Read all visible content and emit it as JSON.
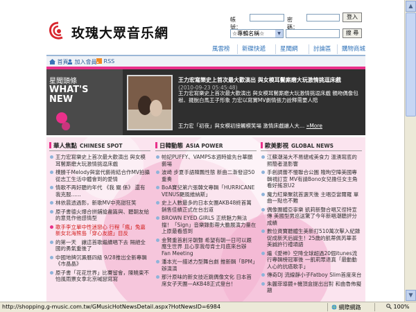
{
  "header": {
    "logo_text": "玫瑰大眾音乐網",
    "login": {
      "account_label": "帳號：",
      "password_label": "密碼：",
      "login_button": "登入"
    },
    "search": {
      "select_value": "☆專輯名稱☆",
      "search_button": "搜 尋"
    },
    "nav_tabs": [
      "風雲榜",
      "新碟快遞",
      "星聞網",
      "討論區",
      "購物商城"
    ]
  },
  "subbar": {
    "home": "首頁",
    "join": "加入會員",
    "rss": "RSS"
  },
  "headline": {
    "label": "星聞頭條",
    "en_line1": "WHAT'S",
    "en_line2": "NEW",
    "title": "王力宏寫樂史上首次最大歡演出 與女模耳鬢廝磨大玩激情挑逗床戲",
    "date": "(2010-09-23 05:45:48)",
    "description": "王力宏寫樂史上首次最大歡演出 與女模耳鬢廝磨大玩激情挑逗床戲 親吻偶像包袱、擺脫白馬王子形象 力宏以寫實MV劇情張力詮釋需要人陪",
    "second": "王力宏「初夜」與女模初接觸模笑場 激情床戲讓人大…",
    "more": "»More"
  },
  "columns": [
    {
      "title": "華人焦點",
      "title_en": "CHINESE SPOT",
      "items": [
        {
          "text": "王力宏寫樂史上首次最大歡演出 與女模耳鬢廝磨大玩激情挑逗床戲"
        },
        {
          "text": "樸勝千Melody與當代藝術結合作MV拍攝 從志工生活中體會到的愛情"
        },
        {
          "text": "情歌不再好聽的年代 《我 關 係》 還有我克服......"
        },
        {
          "text": "林依晨透過影，新歌MV中亮甜狂笑"
        },
        {
          "text": "原子書德火爆合拼鋪搶盡篇與、聽朝友給的意見作他感情型"
        },
        {
          "text": "歌手李立單中性迷戀心 行程「瘋」兔嘉新女北海熊島「穿心友誼」目反",
          "highlight": true
        },
        {
          "text": "的第一天　讓這首歌繼續唱下去 隔絕全國的勇氣重後了"
        },
        {
          "text": "中國地牌沉澱曆四級 9/28推出全新專輯《市晶晶》"
        },
        {
          "text": "原子書「花花世界」比賽留會，陳曉東不怕風雨票女拿北京喊戀寫寫"
        }
      ]
    },
    {
      "title": "日韓動態",
      "title_en": "ASIA POWER",
      "items": [
        {
          "text": "帕妃PUFFY、VAMPS本週時搶先台華願藝場"
        },
        {
          "text": "波崎 步夏手語陳飄性態 新曲二漸發迎50重奏"
        },
        {
          "text": "BoA寶兒第六張韓文專輯「HURRICANE VENUS颶風維納斯」"
        },
        {
          "text": "史上人數最多的日本女團AKB48終首萬銷售佳績正式在台出道"
        },
        {
          "text": "BROWN EYED GIRLS 正統魅力無法擋！「Sign」音樂錄影帶大膽展演力量在上原最看感到"
        },
        {
          "text": "金賢重首創牙朝聲 希望有朝一日可以跟應生世界 且心享我母肯士月底來台辦 Fan Meeting"
        },
        {
          "text": "潘本光一描述力型舞台劇 推新輯「BPM」辦演演"
        },
        {
          "text": "那汁原味的新女技近跳偶像文化 日本首席女子天團—AKB48正式登台！"
        }
      ]
    },
    {
      "title": "歐美影視",
      "title_en": "GLOBAL NEWS",
      "items": [
        {
          "text": "江蘇潮湯大不易總戒美食力 溫湧寫底的照簡者溫影響"
        },
        {
          "text": "手創調蕾不慢聯合公園 隆昫空陣美國專輯視訂宣 MV有請Bono女兒擔任女主角看好搖滾U2"
        },
        {
          "text": "魔力紅樂聚就首選天後 主唱亞當爾羅 單曲一點也不難"
        },
        {
          "text": "偶像團體亞寧樂 凱莉新聲合唱又徑特宣傳 美國型男巡送驚了今年新唱潮聽評分成績"
        },
        {
          "text": "數位資寶聽體生美新打510萬次擊入紀錄 促成新天后誕生！25歲的凱蒂佩芮華茶美誠許行禮頌語"
        },
        {
          "text": "繼《愛神》空降全球超過20個itunes流行專輯榜冠軍後 一凱莉眾退真「最動動人心的抗癌歌手」"
        },
        {
          "text": "傳奇DJ 流線靜小子Fatboy Slim首度來台"
        },
        {
          "text": "朱麗菲導鏡+機頂盒提出出對 和曲魯佈擬題"
        }
      ]
    }
  ],
  "status": {
    "url": "http://shopping.g-music.com.tw/GMusicHotNewsDetail.aspx?HotNewsID=6984",
    "zone": "網際網路",
    "zoom": "100%"
  },
  "colors": {
    "accent": "#e9308a",
    "nav_blue": "#2c70b8",
    "headline_bg": "#2f2f2f"
  }
}
